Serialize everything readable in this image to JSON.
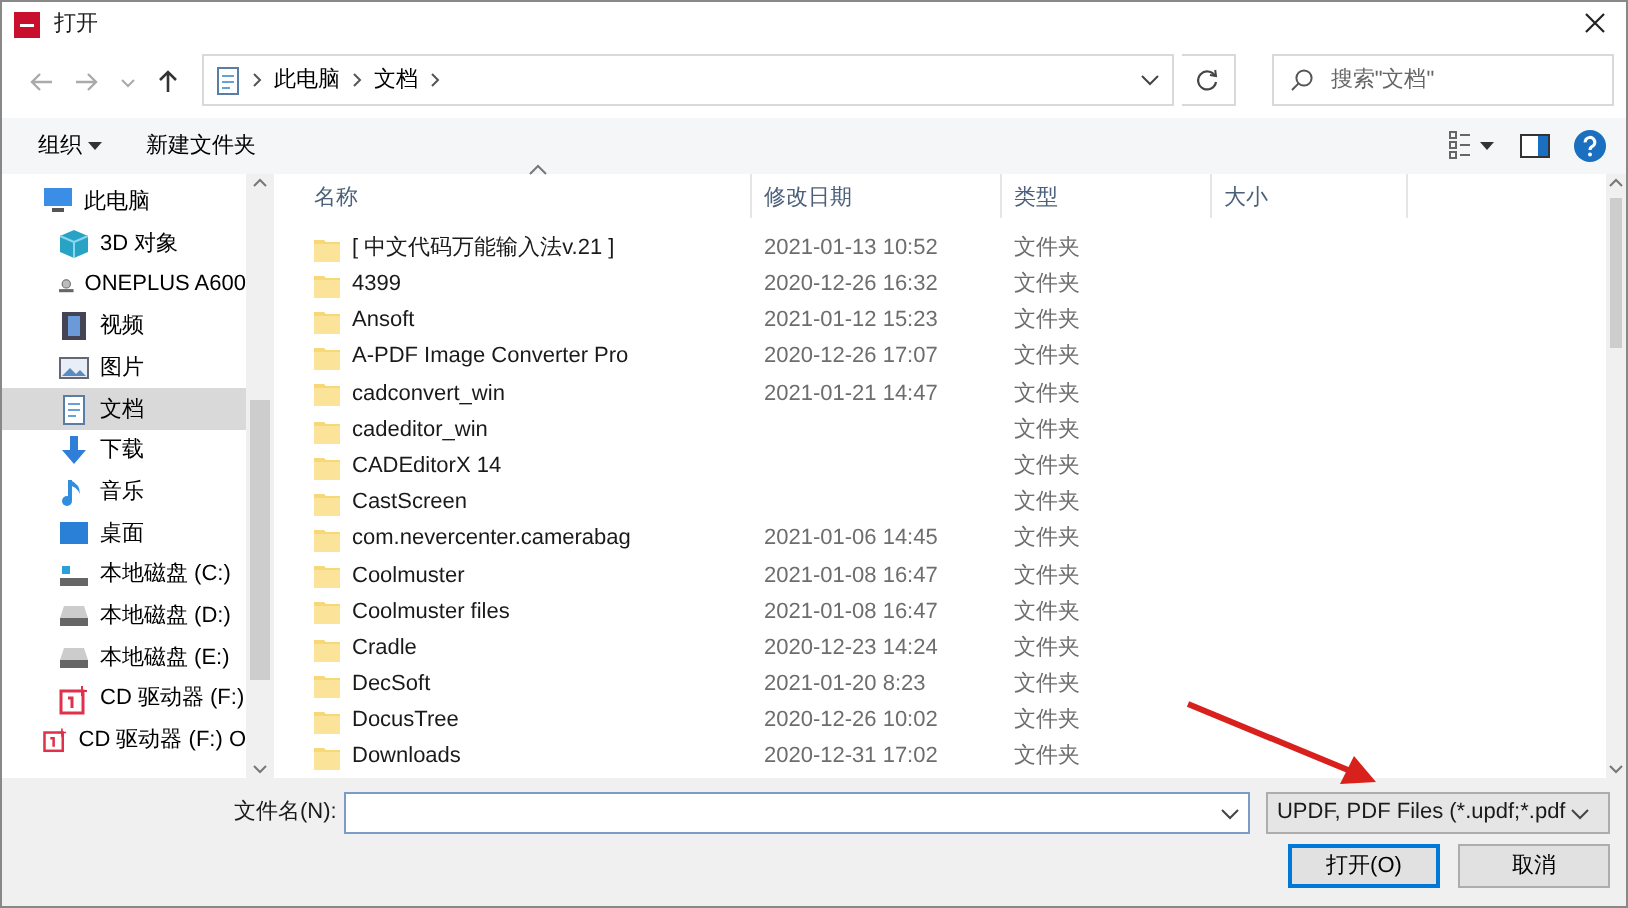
{
  "window": {
    "title": "打开"
  },
  "address": {
    "path": [
      "此电脑",
      "文档"
    ]
  },
  "search": {
    "placeholder": "搜索\"文档\""
  },
  "toolbar": {
    "organize": "组织",
    "new_folder": "新建文件夹"
  },
  "nav": [
    {
      "label": "此电脑",
      "kind": "pc",
      "selected": false,
      "children": [
        {
          "label": "3D 对象",
          "kind": "cube",
          "selected": false
        },
        {
          "label": "ONEPLUS A600",
          "kind": "phone",
          "selected": false
        },
        {
          "label": "视频",
          "kind": "video",
          "selected": false
        },
        {
          "label": "图片",
          "kind": "picture",
          "selected": false
        },
        {
          "label": "文档",
          "kind": "docs",
          "selected": true
        },
        {
          "label": "下载",
          "kind": "download",
          "selected": false
        },
        {
          "label": "音乐",
          "kind": "music",
          "selected": false
        },
        {
          "label": "桌面",
          "kind": "desktop",
          "selected": false
        },
        {
          "label": "本地磁盘 (C:)",
          "kind": "sysdisk",
          "selected": false
        },
        {
          "label": "本地磁盘 (D:)",
          "kind": "disk",
          "selected": false
        },
        {
          "label": "本地磁盘 (E:)",
          "kind": "disk",
          "selected": false
        },
        {
          "label": "CD 驱动器 (F:)",
          "kind": "cd",
          "selected": false
        }
      ]
    },
    {
      "label": "CD 驱动器 (F:) O",
      "kind": "cd",
      "selected": false
    }
  ],
  "columns": [
    {
      "label": "名称",
      "sorted": true
    },
    {
      "label": "修改日期",
      "sorted": false
    },
    {
      "label": "类型",
      "sorted": false
    },
    {
      "label": "大小",
      "sorted": false
    }
  ],
  "files": [
    {
      "name": "[ 中文代码万能输入法v.21 ]",
      "date": "2021-01-13 10:52",
      "type": "文件夹"
    },
    {
      "name": "4399",
      "date": "2020-12-26 16:32",
      "type": "文件夹"
    },
    {
      "name": "Ansoft",
      "date": "2021-01-12 15:23",
      "type": "文件夹"
    },
    {
      "name": "A-PDF Image Converter Pro",
      "date": "2020-12-26 17:07",
      "type": "文件夹"
    },
    {
      "name": "cadconvert_win",
      "date": "2021-01-21 14:47",
      "type": "文件夹"
    },
    {
      "name": "cadeditor_win",
      "type": "文件夹"
    },
    {
      "name": "CADEditorX 14",
      "type": "文件夹"
    },
    {
      "name": "CastScreen",
      "type": "文件夹"
    },
    {
      "name": "com.nevercenter.camerabag",
      "date": "2021-01-06 14:45",
      "type": "文件夹"
    },
    {
      "name": "Coolmuster",
      "date": "2021-01-08 16:47",
      "type": "文件夹"
    },
    {
      "name": "Coolmuster files",
      "date": "2021-01-08 16:47",
      "type": "文件夹"
    },
    {
      "name": "Cradle",
      "date": "2020-12-23 14:24",
      "type": "文件夹"
    },
    {
      "name": "DecSoft",
      "date": "2021-01-20 8:23",
      "type": "文件夹"
    },
    {
      "name": "DocusTree",
      "date": "2020-12-26 10:02",
      "type": "文件夹"
    },
    {
      "name": "Downloads",
      "date": "2020-12-31 17:02",
      "type": "文件夹"
    }
  ],
  "footer": {
    "filename_label": "文件名(N):",
    "filter": "UPDF, PDF Files (*.updf;*.pdf",
    "buttons": [
      {
        "label": "打开(O)",
        "kind": "primary"
      },
      {
        "label": "取消",
        "kind": "normal"
      }
    ]
  }
}
